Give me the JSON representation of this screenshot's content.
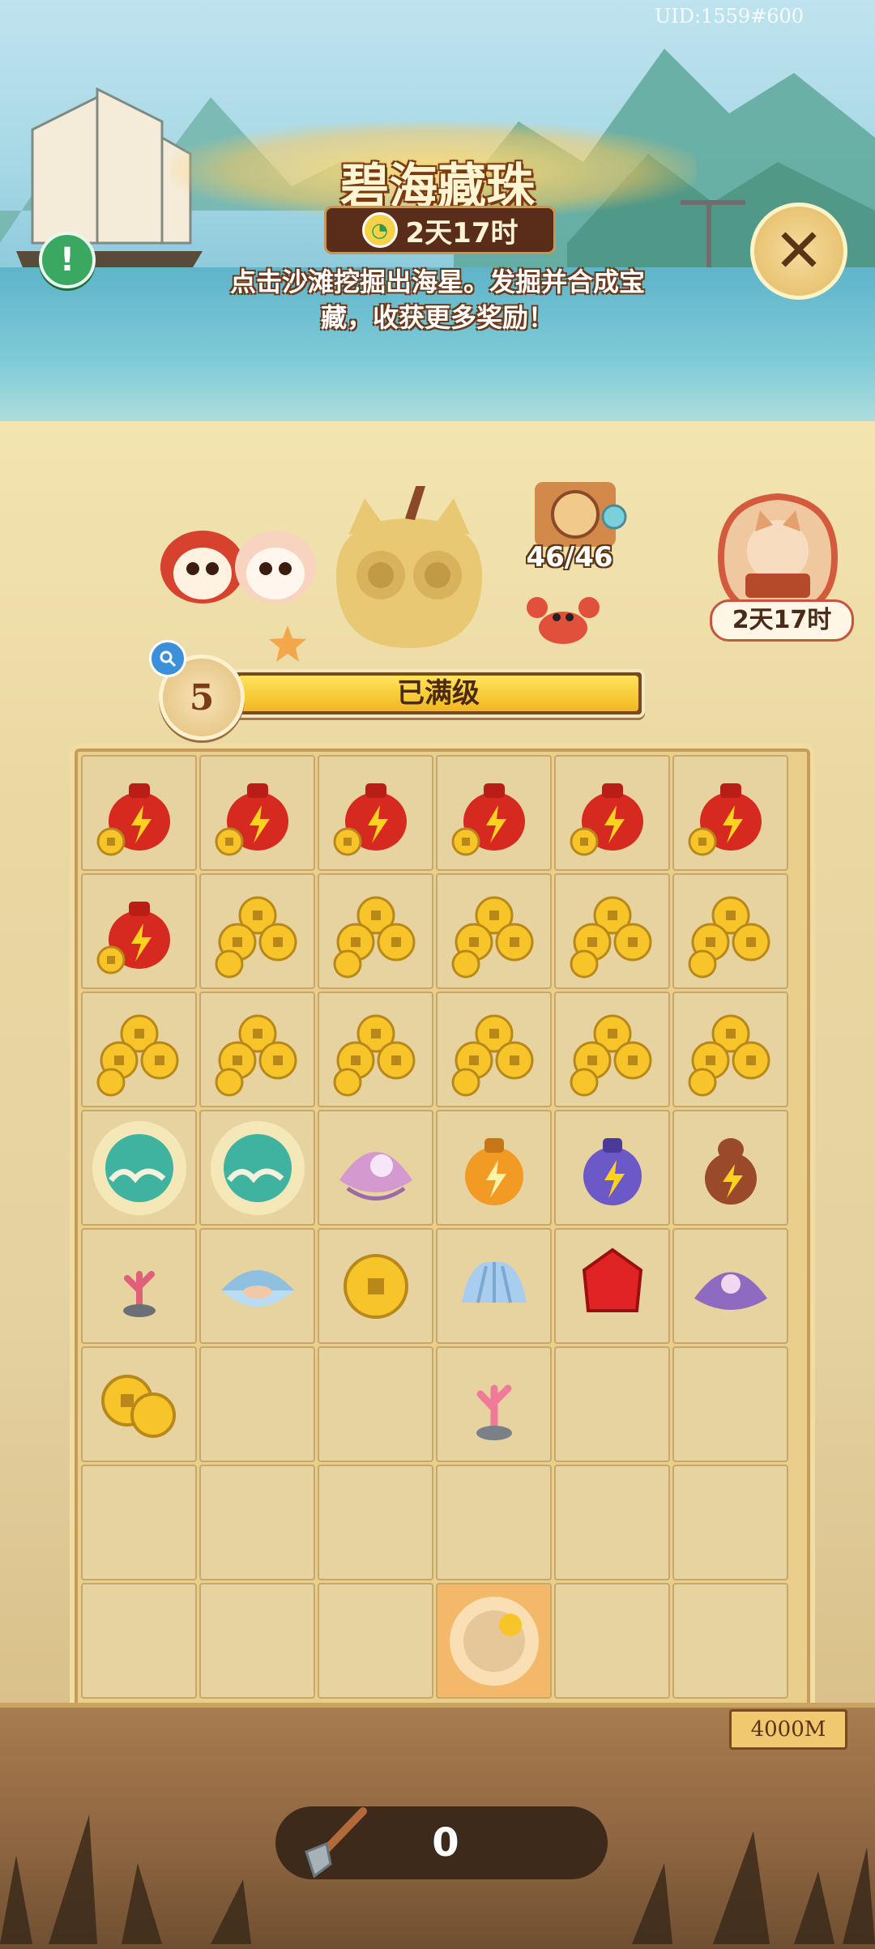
{
  "uid_text": "UID:1559#600",
  "event": {
    "title": "碧海藏珠",
    "time_remaining": "2天17时",
    "description": "点击沙滩挖掘出海星。发掘并合成宝藏，收获更多奖励！"
  },
  "buttons": {
    "info_symbol": "!",
    "close_symbol": "✕"
  },
  "scroll_counter": "46/46",
  "side_event": {
    "time_remaining": "2天17时"
  },
  "level": {
    "number": "5",
    "status": "已满级"
  },
  "board": {
    "columns": 6,
    "rows": [
      [
        "red-energy-jar",
        "red-energy-jar",
        "red-energy-jar",
        "red-energy-jar",
        "red-energy-jar",
        "red-energy-jar"
      ],
      [
        "red-energy-jar",
        "gold-coin-pile",
        "gold-coin-pile",
        "gold-coin-pile",
        "gold-coin-pile",
        "gold-coin-pile"
      ],
      [
        "gold-coin-pile",
        "gold-coin-pile",
        "gold-coin-pile",
        "gold-coin-pile",
        "gold-coin-pile",
        "gold-coin-pile"
      ],
      [
        "jade-cloud-orb",
        "jade-cloud-orb",
        "pink-pearl-shell",
        "orange-energy-jar",
        "purple-energy-jar",
        "brown-energy-jar"
      ],
      [
        "small-coral",
        "clam-shell",
        "single-gold-coin",
        "blue-seashell",
        "red-gem",
        "purple-pearl-shell"
      ],
      [
        "two-gold-coins",
        "empty",
        "empty",
        "pink-coral",
        "empty",
        "empty"
      ],
      [
        "empty",
        "empty",
        "empty",
        "empty",
        "empty",
        "empty"
      ],
      [
        "empty",
        "empty",
        "empty",
        "treasure-bubble",
        "empty",
        "empty"
      ]
    ]
  },
  "distance": "4000M",
  "shovel_count": "0",
  "colors": {
    "board_bg": "#e9cf8b",
    "cell_bg": "#e7d3a0",
    "level_fill": "#f2b820",
    "accent_brown": "#5a2c1a"
  }
}
